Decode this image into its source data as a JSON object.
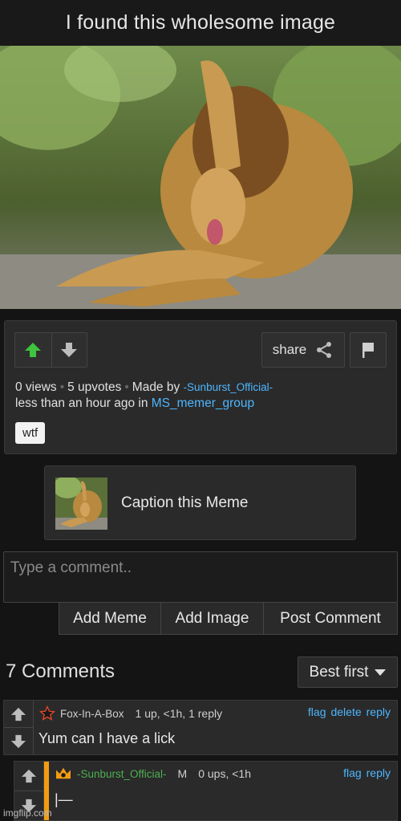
{
  "post": {
    "title": "I found this wholesome image",
    "views": "0 views",
    "upvotes": "5 upvotes",
    "made_by_label": "Made by",
    "author": "-Sunburst_Official-",
    "time_prefix": "less than an hour ago in",
    "stream": "MS_memer_group",
    "tag": "wtf"
  },
  "toolbar": {
    "share_label": "share"
  },
  "caption": {
    "label": "Caption this Meme"
  },
  "comment_box": {
    "placeholder": "Type a comment..",
    "add_meme_label": "Add Meme",
    "add_image_label": "Add Image",
    "post_comment_label": "Post Comment"
  },
  "comments_section": {
    "count_label": "7 Comments",
    "sort_label": "Best first"
  },
  "comments": [
    {
      "user": "Fox-In-A-Box",
      "meta": "1 up, <1h, 1 reply",
      "actions": [
        "flag",
        "delete",
        "reply"
      ],
      "text": "Yum can I have a lick",
      "icon": "star-icon"
    },
    {
      "user": "-Sunburst_Official-",
      "badge": "M",
      "meta": "0 ups, <1h",
      "actions": [
        "flag",
        "reply"
      ],
      "text": "|—",
      "icon": "crown-icon"
    }
  ],
  "watermark": "imgflip.com",
  "colors": {
    "upvote_active": "#3ec43e",
    "link": "#4db6ff",
    "op_bar": "#f39c12",
    "op_user": "#4caf50"
  }
}
